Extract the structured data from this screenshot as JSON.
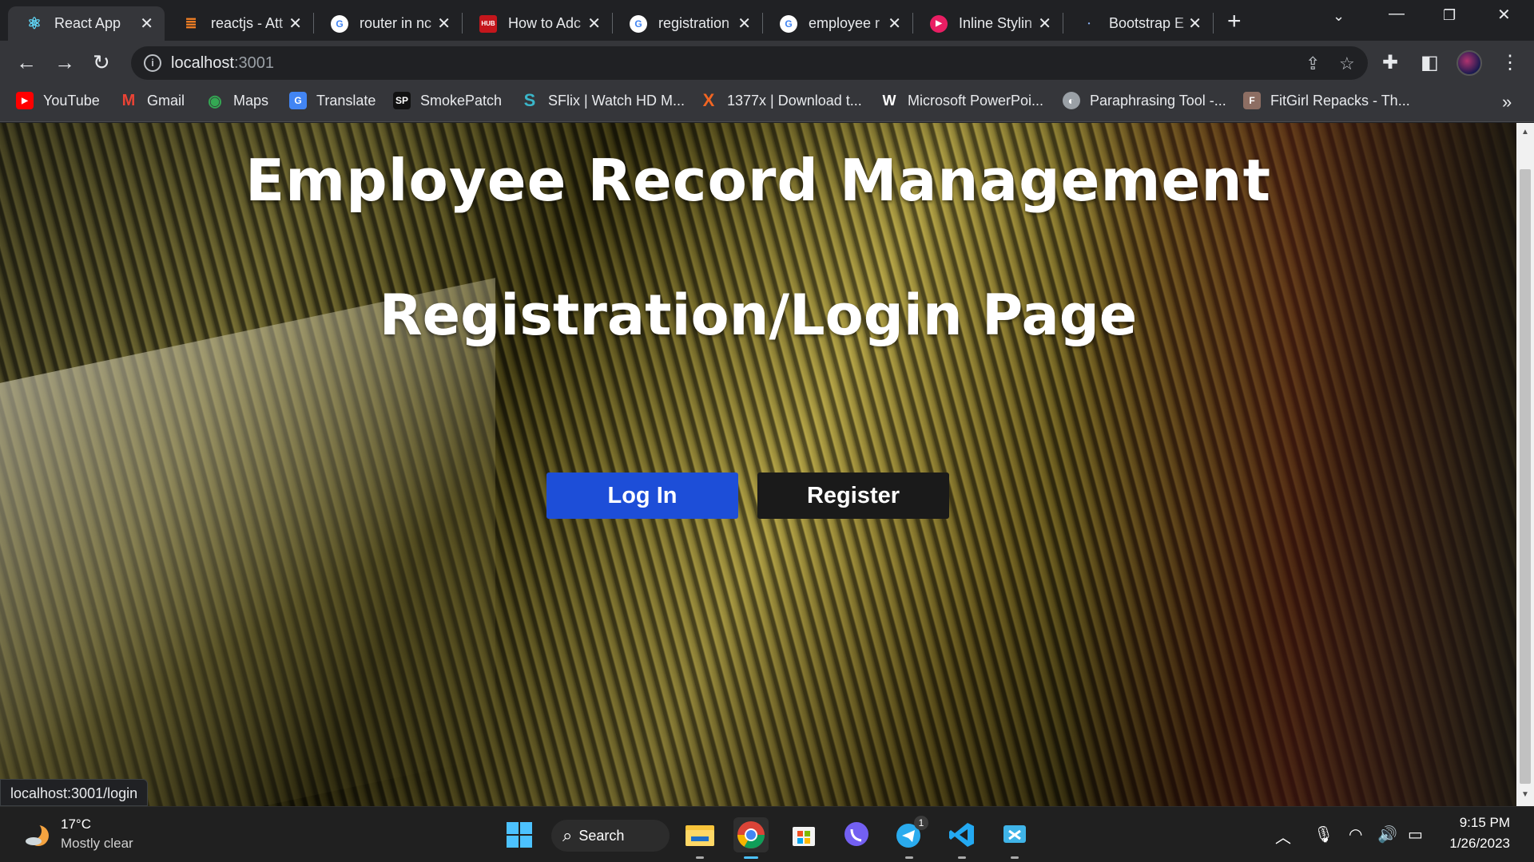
{
  "browser": {
    "tabs": [
      {
        "title": "React App",
        "active": true,
        "icon": "react-icon"
      },
      {
        "title": "reactjs - Att",
        "active": false,
        "icon": "stackoverflow-icon"
      },
      {
        "title": "router in nc",
        "active": false,
        "icon": "google-icon"
      },
      {
        "title": "How to Adc",
        "active": false,
        "icon": "hub-icon"
      },
      {
        "title": "registration",
        "active": false,
        "icon": "google-icon"
      },
      {
        "title": "employee r",
        "active": false,
        "icon": "google-icon"
      },
      {
        "title": "Inline Stylin",
        "active": false,
        "icon": "play-icon"
      },
      {
        "title": "Bootstrap E",
        "active": false,
        "icon": "loading-icon"
      }
    ],
    "address": {
      "host": "localhost",
      "port": ":3001"
    },
    "bookmarks": [
      {
        "label": "YouTube",
        "icon": "youtube-icon"
      },
      {
        "label": "Gmail",
        "icon": "gmail-icon"
      },
      {
        "label": "Maps",
        "icon": "maps-icon"
      },
      {
        "label": "Translate",
        "icon": "translate-icon"
      },
      {
        "label": "SmokePatch",
        "icon": "smokepatch-icon"
      },
      {
        "label": "SFlix | Watch HD M...",
        "icon": "sflix-icon"
      },
      {
        "label": "1377x | Download t...",
        "icon": "1377x-icon"
      },
      {
        "label": "Microsoft PowerPoi...",
        "icon": "word-w-icon"
      },
      {
        "label": "Paraphrasing Tool -...",
        "icon": "globe-icon"
      },
      {
        "label": "FitGirl Repacks - Th...",
        "icon": "fitgirl-icon"
      }
    ],
    "status_url": "localhost:3001/login"
  },
  "page": {
    "title": "Employee Record Management",
    "subtitle": "Registration/Login Page",
    "login_label": "Log In",
    "register_label": "Register"
  },
  "taskbar": {
    "weather_temp": "17°C",
    "weather_desc": "Mostly clear",
    "search_label": "Search",
    "time": "9:15 PM",
    "date": "1/26/2023",
    "telegram_badge": "1"
  },
  "colors": {
    "login_button": "#1d4ed8",
    "register_button": "#1a1a1a",
    "tab_bar": "#202124",
    "toolbar": "#35363a"
  }
}
